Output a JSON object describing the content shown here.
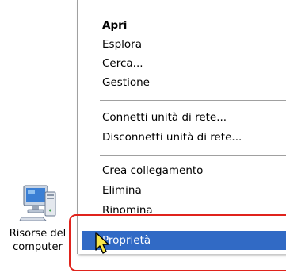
{
  "desktop_icon": {
    "label_line1": "Risorse del",
    "label_line2": "computer",
    "icon": "my-computer-icon"
  },
  "context_menu": {
    "items": [
      {
        "label": "Apri",
        "bold": true
      },
      {
        "label": "Esplora"
      },
      {
        "label": "Cerca..."
      },
      {
        "label": "Gestione"
      },
      {
        "label": "Connetti unità di rete..."
      },
      {
        "label": "Disconnetti unità di rete..."
      },
      {
        "label": "Crea collegamento"
      },
      {
        "label": "Elimina"
      },
      {
        "label": "Rinomina"
      },
      {
        "label": "Proprietà",
        "selected": true
      }
    ],
    "highlight_color": "#e0231c",
    "selection_color": "#316ac5"
  },
  "cursor": {
    "icon": "mouse-pointer-icon"
  }
}
